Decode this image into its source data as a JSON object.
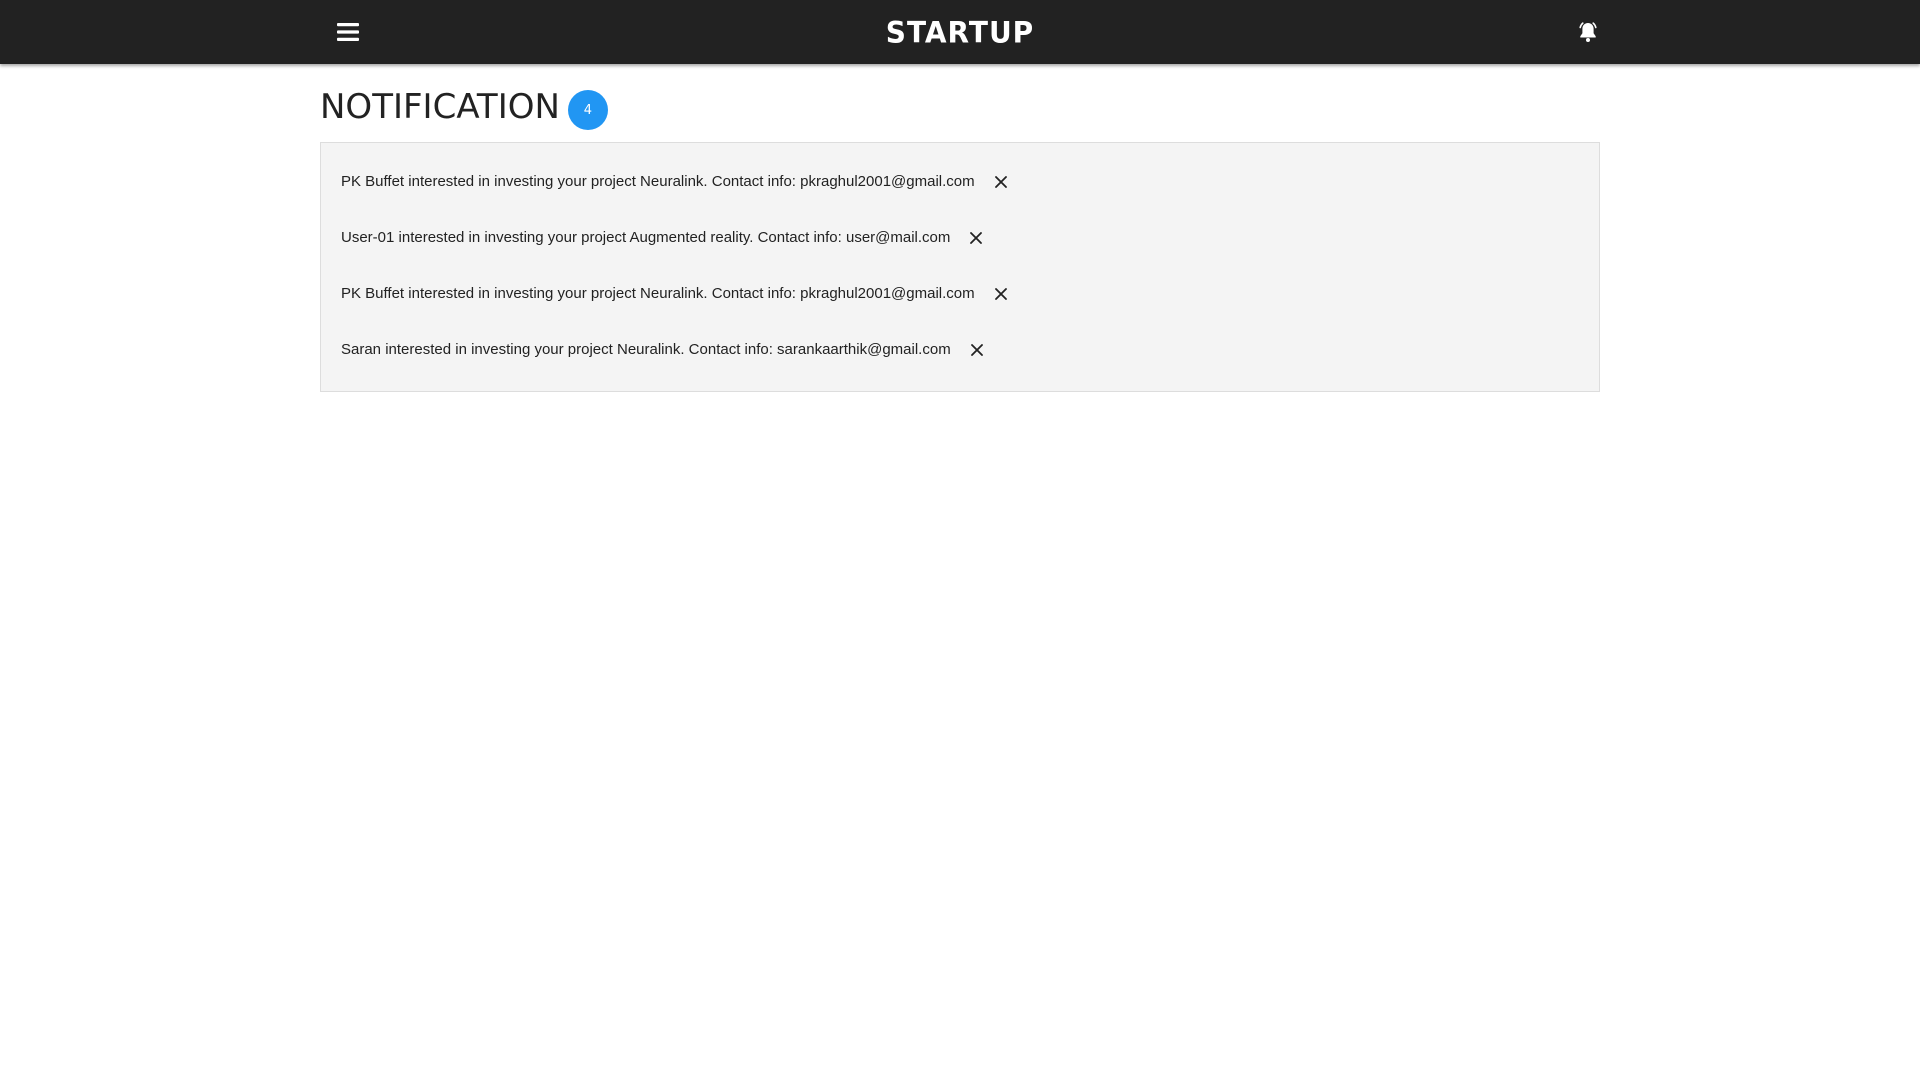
{
  "header": {
    "brand": "STARTUP",
    "menu_icon": "hamburger-menu-icon",
    "bell_icon": "bell-icon",
    "background": "#222222"
  },
  "page": {
    "title": "NOTIFICATION",
    "count": "4",
    "badge_color": "#2196f3"
  },
  "notifications": [
    {
      "text": "PK Buffet interested in investing your project Neuralink. Contact info: pkraghul2001@gmail.com"
    },
    {
      "text": "User-01 interested in investing your project Augmented reality. Contact info: user@mail.com"
    },
    {
      "text": "PK Buffet interested in investing your project Neuralink. Contact info: pkraghul2001@gmail.com"
    },
    {
      "text": "Saran interested in investing your project Neuralink. Contact info: sarankaarthik@gmail.com"
    }
  ]
}
